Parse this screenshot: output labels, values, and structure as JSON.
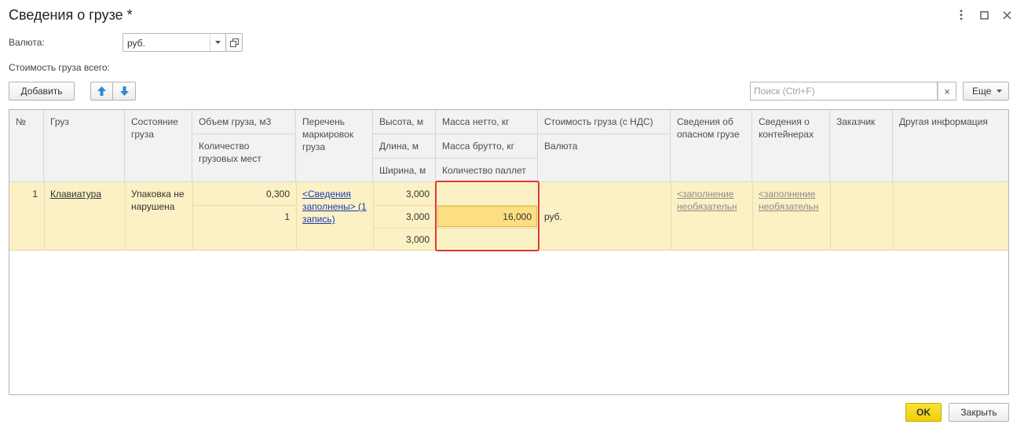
{
  "window": {
    "title": "Сведения о грузе *",
    "more_icon": "vertical-dots-icon",
    "maximize_icon": "square-icon",
    "close_icon": "close-icon"
  },
  "form": {
    "currency_label": "Валюта:",
    "currency_value": "руб.",
    "total_cost_label": "Стоимость груза всего:"
  },
  "toolbar": {
    "add_label": "Добавить",
    "search_placeholder": "Поиск (Ctrl+F)",
    "search_clear": "×",
    "more_label": "Еще"
  },
  "table": {
    "headers": {
      "num": "№",
      "cargo": "Груз",
      "state": "Состояние груза",
      "volume": "Объем груза, м3",
      "places": "Количество грузовых мест",
      "markings": "Перечень маркировок груза",
      "height": "Высота, м",
      "length": "Длина, м",
      "width": "Ширина, м",
      "net": "Масса нетто, кг",
      "gross": "Масса брутто, кг",
      "pallets": "Количество паллет",
      "cost": "Стоимость груза (с НДС)",
      "currency": "Валюта",
      "danger": "Сведения об опасном грузе",
      "containers": "Сведения о контейнерах",
      "customer": "Заказчик",
      "other": "Другая информация"
    },
    "rows": [
      {
        "num": "1",
        "cargo": "Клавиатура",
        "state": "Упаковка не нарушена",
        "volume": "0,300",
        "places": "1",
        "markings": "<Сведения заполнены> (1 запись)",
        "height": "3,000",
        "length": "3,000",
        "width": "3,000",
        "net": "",
        "gross": "16,000",
        "pallets": "",
        "cost": "",
        "currency": "руб.",
        "danger": "<заполнение необязательн",
        "containers": "<заполнение необязательн",
        "customer": "",
        "other": ""
      }
    ]
  },
  "footer": {
    "ok_label": "OK",
    "close_label": "Закрыть"
  },
  "colors": {
    "row_highlight": "#fbf1c4",
    "selected_cell": "#fddf81",
    "annotation_border": "#d83a3a",
    "ok_button": "#f5d60f",
    "link": "#1a3ab8"
  }
}
